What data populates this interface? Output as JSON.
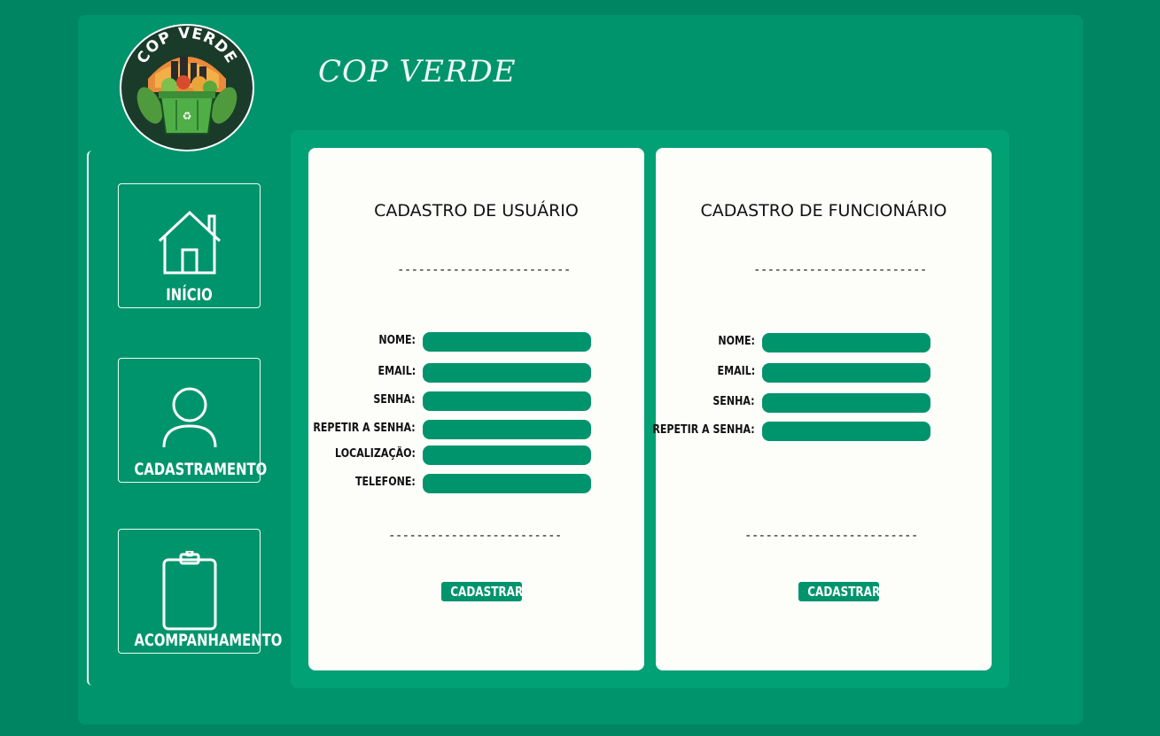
{
  "app": {
    "title": "COP VERDE",
    "logo_text": "COP VERDE"
  },
  "nav": {
    "items": [
      {
        "label": "INÍCIO",
        "icon": "house-icon"
      },
      {
        "label": "CADASTRAMENTO",
        "icon": "user-icon"
      },
      {
        "label": "ACOMPANHAMENTO",
        "icon": "clipboard-icon"
      }
    ]
  },
  "separator": "-------------------------",
  "user_form": {
    "title": "CADASTRO DE USUÁRIO",
    "fields": [
      {
        "label": "NOME:",
        "value": ""
      },
      {
        "label": "EMAIL:",
        "value": ""
      },
      {
        "label": "SENHA:",
        "value": ""
      },
      {
        "label": "REPETIR A SENHA:",
        "value": ""
      },
      {
        "label": "LOCALIZAÇÃO:",
        "value": ""
      },
      {
        "label": "TELEFONE:",
        "value": ""
      }
    ],
    "submit_label": "CADASTRAR"
  },
  "employee_form": {
    "title": "CADASTRO DE FUNCIONÁRIO",
    "fields": [
      {
        "label": "NOME:",
        "value": ""
      },
      {
        "label": "EMAIL:",
        "value": ""
      },
      {
        "label": "SENHA:",
        "value": ""
      },
      {
        "label": "REPETIR A SENHA:",
        "value": ""
      }
    ],
    "submit_label": "CADASTRAR"
  },
  "colors": {
    "page_bg": "#008562",
    "app_bg": "#00946d",
    "panel_bg": "#02a075",
    "card_bg": "#fdfefa",
    "accent": "#00946d"
  }
}
